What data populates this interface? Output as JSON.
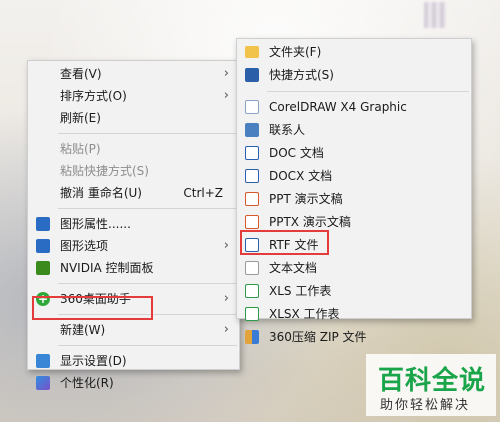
{
  "main_menu": {
    "items": [
      {
        "label": "查看(V)",
        "submenu": true
      },
      {
        "label": "排序方式(O)",
        "submenu": true
      },
      {
        "label": "刷新(E)"
      },
      {
        "label": "粘贴(P)",
        "disabled": true
      },
      {
        "label": "粘贴快捷方式(S)",
        "disabled": true
      },
      {
        "label": "撤消 重命名(U)",
        "shortcut": "Ctrl+Z"
      },
      {
        "label": "图形属性......"
      },
      {
        "label": "图形选项",
        "submenu": true
      },
      {
        "label": "NVIDIA 控制面板"
      },
      {
        "label": "360桌面助手",
        "submenu": true
      },
      {
        "label": "新建(W)",
        "submenu": true
      },
      {
        "label": "显示设置(D)"
      },
      {
        "label": "个性化(R)"
      }
    ]
  },
  "new_submenu": {
    "items": [
      {
        "label": "文件夹(F)",
        "icon": "folder-icon"
      },
      {
        "label": "快捷方式(S)",
        "icon": "shortcut-icon"
      },
      {
        "label": "CorelDRAW X4 Graphic",
        "icon": "blank-icon"
      },
      {
        "label": "联系人",
        "icon": "contact-icon"
      },
      {
        "label": "DOC 文档",
        "icon": "word-icon"
      },
      {
        "label": "DOCX 文档",
        "icon": "word-icon"
      },
      {
        "label": "PPT 演示文稿",
        "icon": "ppt-icon"
      },
      {
        "label": "PPTX 演示文稿",
        "icon": "ppt-icon"
      },
      {
        "label": "RTF 文件",
        "icon": "rtf-icon"
      },
      {
        "label": "文本文档",
        "icon": "text-doc-icon"
      },
      {
        "label": "XLS 工作表",
        "icon": "excel-icon"
      },
      {
        "label": "XLSX 工作表",
        "icon": "excel-icon"
      },
      {
        "label": "360压缩 ZIP 文件",
        "icon": "zip-icon"
      }
    ]
  },
  "watermark": {
    "title": "百科全说",
    "subtitle": "助你轻松解决"
  },
  "colors": {
    "highlight_box": "#e53b3b",
    "menu_bg": "#f2f2f2",
    "watermark_green": "#1aa54a"
  }
}
